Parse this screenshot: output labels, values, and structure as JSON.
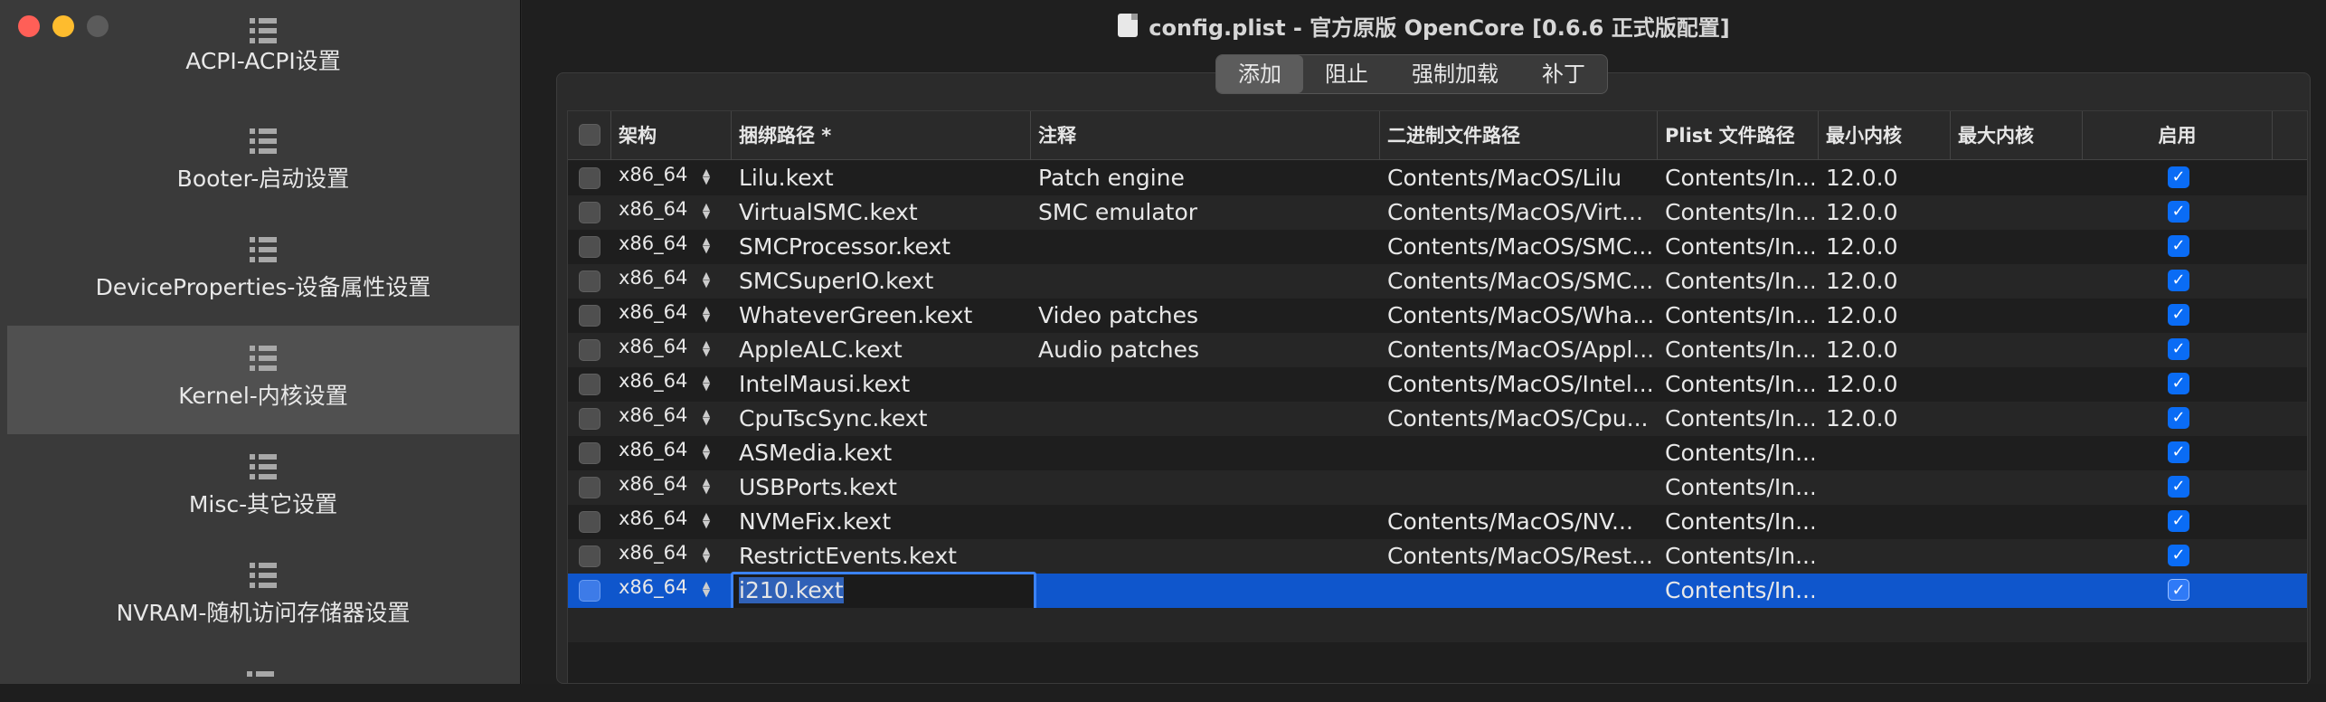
{
  "window": {
    "title": "config.plist - 官方原版 OpenCore [0.6.6 正式版配置]"
  },
  "sidebar": {
    "items": [
      {
        "label": "ACPI-ACPI设置",
        "active": false
      },
      {
        "label": "Booter-启动设置",
        "active": false
      },
      {
        "label": "DeviceProperties-设备属性设置",
        "active": false
      },
      {
        "label": "Kernel-内核设置",
        "active": true
      },
      {
        "label": "Misc-其它设置",
        "active": false
      },
      {
        "label": "NVRAM-随机访问存储器设置",
        "active": false
      }
    ]
  },
  "tabs": [
    "添加",
    "阻止",
    "强制加载",
    "补丁"
  ],
  "selected_tab": "添加",
  "table": {
    "columns": [
      "架构",
      "捆绑路径 *",
      "注释",
      "二进制文件路径",
      "Plist 文件路径",
      "最小内核",
      "最大内核",
      "启用"
    ],
    "rows": [
      {
        "arch": "x86_64",
        "bundle": "Lilu.kext",
        "comment": "Patch engine",
        "binary": "Contents/MacOS/Lilu",
        "plist": "Contents/In...",
        "min": "12.0.0",
        "max": "",
        "enabled": true
      },
      {
        "arch": "x86_64",
        "bundle": "VirtualSMC.kext",
        "comment": "SMC emulator",
        "binary": "Contents/MacOS/Virt...",
        "plist": "Contents/In...",
        "min": "12.0.0",
        "max": "",
        "enabled": true
      },
      {
        "arch": "x86_64",
        "bundle": "SMCProcessor.kext",
        "comment": "",
        "binary": "Contents/MacOS/SMC...",
        "plist": "Contents/In...",
        "min": "12.0.0",
        "max": "",
        "enabled": true
      },
      {
        "arch": "x86_64",
        "bundle": "SMCSuperIO.kext",
        "comment": "",
        "binary": "Contents/MacOS/SMC...",
        "plist": "Contents/In...",
        "min": "12.0.0",
        "max": "",
        "enabled": true
      },
      {
        "arch": "x86_64",
        "bundle": "WhateverGreen.kext",
        "comment": "Video patches",
        "binary": "Contents/MacOS/Wha...",
        "plist": "Contents/In...",
        "min": "12.0.0",
        "max": "",
        "enabled": true
      },
      {
        "arch": "x86_64",
        "bundle": "AppleALC.kext",
        "comment": "Audio patches",
        "binary": "Contents/MacOS/Appl...",
        "plist": "Contents/In...",
        "min": "12.0.0",
        "max": "",
        "enabled": true
      },
      {
        "arch": "x86_64",
        "bundle": "IntelMausi.kext",
        "comment": "",
        "binary": "Contents/MacOS/Intel...",
        "plist": "Contents/In...",
        "min": "12.0.0",
        "max": "",
        "enabled": true
      },
      {
        "arch": "x86_64",
        "bundle": "CpuTscSync.kext",
        "comment": "",
        "binary": "Contents/MacOS/Cpu...",
        "plist": "Contents/In...",
        "min": "12.0.0",
        "max": "",
        "enabled": true
      },
      {
        "arch": "x86_64",
        "bundle": "ASMedia.kext",
        "comment": "",
        "binary": "",
        "plist": "Contents/In...",
        "min": "",
        "max": "",
        "enabled": true
      },
      {
        "arch": "x86_64",
        "bundle": "USBPorts.kext",
        "comment": "",
        "binary": "",
        "plist": "Contents/In...",
        "min": "",
        "max": "",
        "enabled": true
      },
      {
        "arch": "x86_64",
        "bundle": "NVMeFix.kext",
        "comment": "",
        "binary": "Contents/MacOS/NV...",
        "plist": "Contents/In...",
        "min": "",
        "max": "",
        "enabled": true
      },
      {
        "arch": "x86_64",
        "bundle": "RestrictEvents.kext",
        "comment": "",
        "binary": "Contents/MacOS/Rest...",
        "plist": "Contents/In...",
        "min": "",
        "max": "",
        "enabled": true
      },
      {
        "arch": "x86_64",
        "bundle": "i210.kext",
        "comment": "",
        "binary": "",
        "plist": "Contents/In...",
        "min": "",
        "max": "",
        "enabled": true,
        "selected": true
      }
    ]
  }
}
